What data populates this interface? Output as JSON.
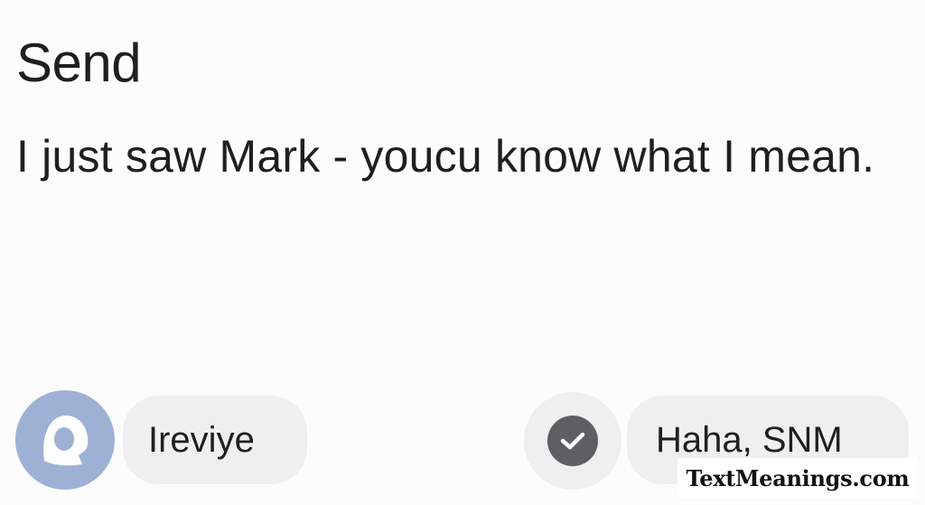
{
  "header": {
    "title": "Send"
  },
  "message": {
    "text": "I just saw Mark - youcu know what I mean."
  },
  "replies": {
    "left": {
      "avatar_icon": "person-silhouette-icon",
      "avatar_color": "#9eb1d4",
      "label": "Ireviye"
    },
    "right": {
      "status_icon": "check-circle-icon",
      "label": "Haha, SNM"
    }
  },
  "watermark": {
    "text": "TextMeanings.com"
  }
}
